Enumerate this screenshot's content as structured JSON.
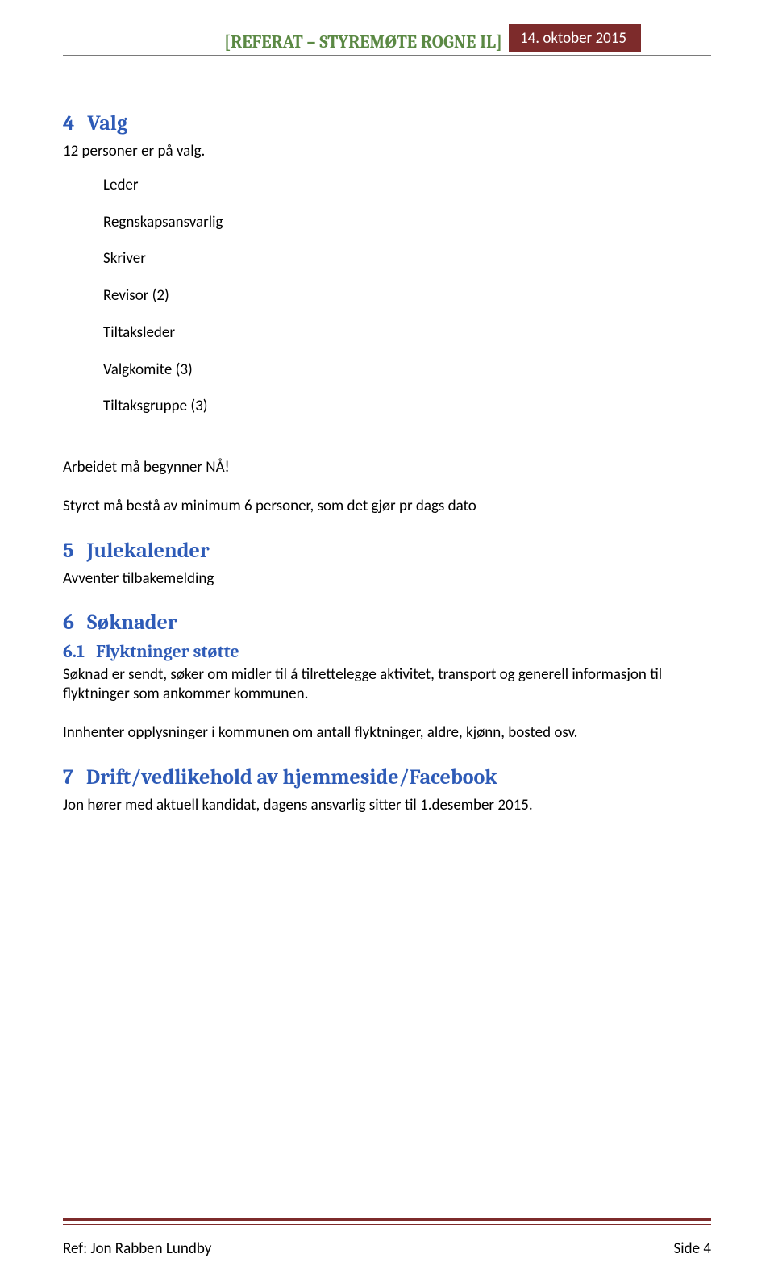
{
  "header": {
    "title_left_bracket": "[",
    "title_text": "REFERAT – STYREMØTE ROGNE IL",
    "title_right_bracket": "]",
    "date": "14. oktober 2015"
  },
  "sections": {
    "s4": {
      "num": "4",
      "title": "Valg",
      "line1": "12 personer er på valg.",
      "roles": {
        "r1": "Leder",
        "r2": "Regnskapsansvarlig",
        "r3": "Skriver",
        "r4": "Revisor (2)",
        "r5": "Tiltaksleder",
        "r6": "Valgkomite (3)",
        "r7": "Tiltaksgruppe (3)"
      },
      "line2": "Arbeidet må begynner NÅ!",
      "line3": "Styret må bestå av minimum 6 personer, som det gjør pr dags dato"
    },
    "s5": {
      "num": "5",
      "title": "Julekalender",
      "line1": "Avventer tilbakemelding"
    },
    "s6": {
      "num": "6",
      "title": "Søknader",
      "sub1": {
        "num": "6.1",
        "title": "Flyktninger støtte",
        "line1": "Søknad er sendt, søker om midler til å tilrettelegge aktivitet, transport og generell informasjon til flyktninger som ankommer kommunen.",
        "line2": "Innhenter opplysninger i kommunen om antall flyktninger, aldre, kjønn, bosted osv."
      }
    },
    "s7": {
      "num": "7",
      "title": "Drift/vedlikehold av hjemmeside/Facebook",
      "line1": "Jon hører med aktuell kandidat, dagens ansvarlig sitter til 1.desember 2015."
    }
  },
  "footer": {
    "ref": "Ref: Jon Rabben Lundby",
    "page": "Side 4"
  }
}
